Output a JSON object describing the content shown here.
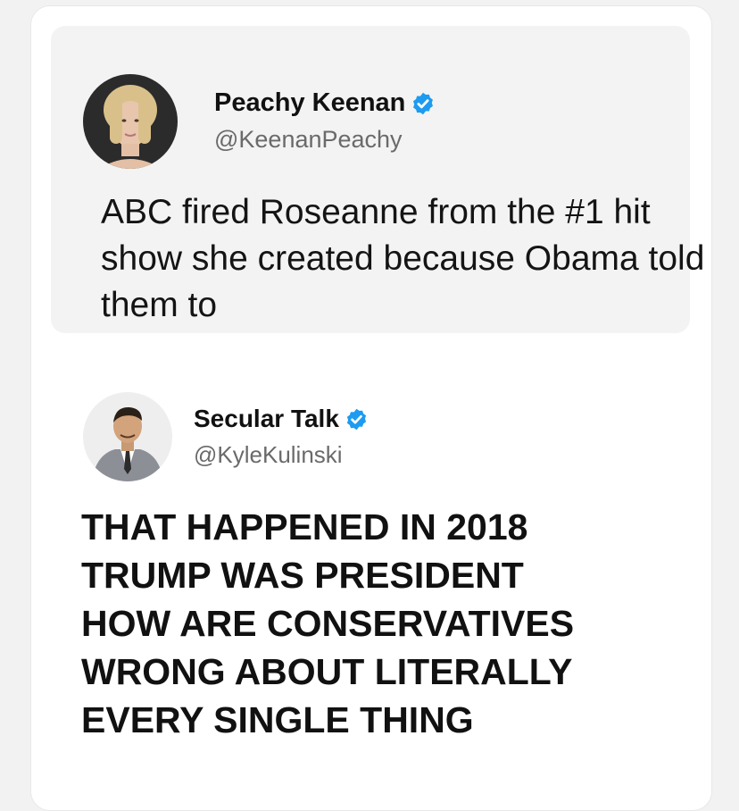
{
  "quoted_tweet": {
    "author_name": "Peachy Keenan",
    "author_handle": "@KeenanPeachy",
    "verified": true,
    "text": "ABC fired Roseanne from the #1 hit show she created because Obama told them to"
  },
  "reply_tweet": {
    "author_name": "Secular Talk",
    "author_handle": "@KyleKulinski",
    "verified": true,
    "text_lines": [
      "THAT HAPPENED IN 2018",
      "TRUMP WAS PRESIDENT",
      "HOW ARE CONSERVATIVES",
      "WRONG ABOUT LITERALLY",
      "EVERY SINGLE THING"
    ]
  },
  "colors": {
    "verified_badge": "#1d9bf0",
    "handle_text": "#6a6a6a",
    "quoted_background": "#f3f3f3"
  },
  "icons": {
    "verified": "verified-badge-icon"
  }
}
